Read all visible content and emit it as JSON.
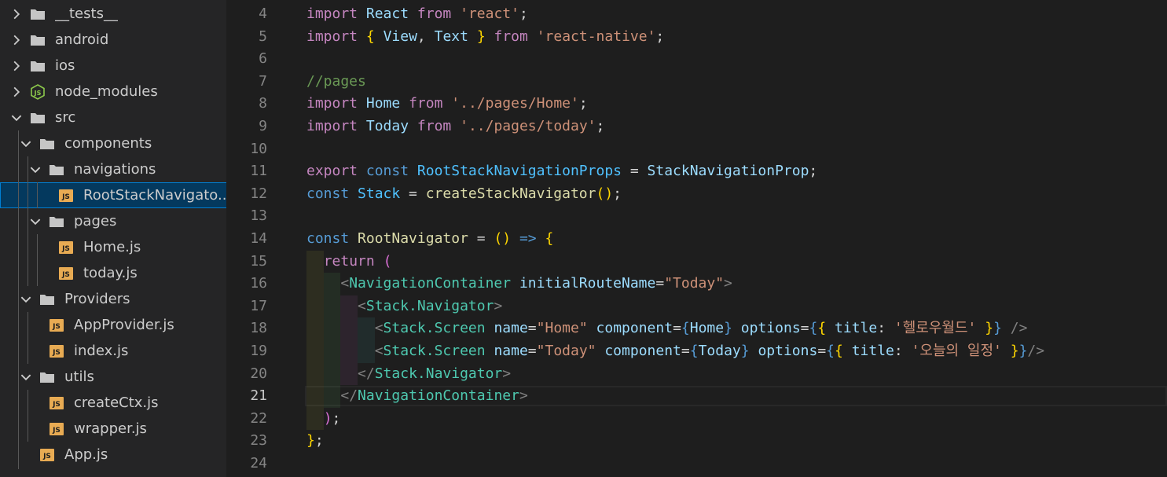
{
  "explorer": {
    "items": [
      {
        "label": "__tests__",
        "type": "folder",
        "depth": 0,
        "expanded": false
      },
      {
        "label": "android",
        "type": "folder",
        "depth": 0,
        "expanded": false
      },
      {
        "label": "ios",
        "type": "folder",
        "depth": 0,
        "expanded": false
      },
      {
        "label": "node_modules",
        "type": "node-folder",
        "depth": 0,
        "expanded": false
      },
      {
        "label": "src",
        "type": "folder",
        "depth": 0,
        "expanded": true
      },
      {
        "label": "components",
        "type": "folder",
        "depth": 1,
        "expanded": true
      },
      {
        "label": "navigations",
        "type": "folder",
        "depth": 2,
        "expanded": true
      },
      {
        "label": "RootStackNavigato...",
        "type": "js",
        "depth": 3,
        "selected": true
      },
      {
        "label": "pages",
        "type": "folder",
        "depth": 2,
        "expanded": true
      },
      {
        "label": "Home.js",
        "type": "js",
        "depth": 3
      },
      {
        "label": "today.js",
        "type": "js",
        "depth": 3
      },
      {
        "label": "Providers",
        "type": "folder",
        "depth": 1,
        "expanded": true
      },
      {
        "label": "AppProvider.js",
        "type": "js",
        "depth": 2
      },
      {
        "label": "index.js",
        "type": "js",
        "depth": 2
      },
      {
        "label": "utils",
        "type": "folder",
        "depth": 1,
        "expanded": true
      },
      {
        "label": "createCtx.js",
        "type": "js",
        "depth": 2
      },
      {
        "label": "wrapper.js",
        "type": "js",
        "depth": 2
      },
      {
        "label": "App.js",
        "type": "js",
        "depth": 1
      }
    ],
    "js_badge": "JS"
  },
  "editor": {
    "active_line": "21",
    "lines": [
      {
        "n": "4",
        "tokens": [
          [
            "k",
            "import"
          ],
          [
            "p",
            " "
          ],
          [
            "v",
            "React"
          ],
          [
            "p",
            " "
          ],
          [
            "k",
            "from"
          ],
          [
            "p",
            " "
          ],
          [
            "s",
            "'react'"
          ],
          [
            "p",
            ";"
          ]
        ]
      },
      {
        "n": "5",
        "tokens": [
          [
            "k",
            "import"
          ],
          [
            "p",
            " "
          ],
          [
            "br1",
            "{"
          ],
          [
            "p",
            " "
          ],
          [
            "v",
            "View"
          ],
          [
            "p",
            ", "
          ],
          [
            "v",
            "Text"
          ],
          [
            "p",
            " "
          ],
          [
            "br1",
            "}"
          ],
          [
            "p",
            " "
          ],
          [
            "k",
            "from"
          ],
          [
            "p",
            " "
          ],
          [
            "s",
            "'react-native'"
          ],
          [
            "p",
            ";"
          ]
        ]
      },
      {
        "n": "6",
        "tokens": []
      },
      {
        "n": "7",
        "tokens": [
          [
            "c",
            "//pages"
          ]
        ]
      },
      {
        "n": "8",
        "tokens": [
          [
            "k",
            "import"
          ],
          [
            "p",
            " "
          ],
          [
            "v",
            "Home"
          ],
          [
            "p",
            " "
          ],
          [
            "k",
            "from"
          ],
          [
            "p",
            " "
          ],
          [
            "s",
            "'../pages/Home'"
          ],
          [
            "p",
            ";"
          ]
        ]
      },
      {
        "n": "9",
        "tokens": [
          [
            "k",
            "import"
          ],
          [
            "p",
            " "
          ],
          [
            "v",
            "Today"
          ],
          [
            "p",
            " "
          ],
          [
            "k",
            "from"
          ],
          [
            "p",
            " "
          ],
          [
            "s",
            "'../pages/today'"
          ],
          [
            "p",
            ";"
          ]
        ]
      },
      {
        "n": "10",
        "tokens": []
      },
      {
        "n": "11",
        "tokens": [
          [
            "k",
            "export"
          ],
          [
            "p",
            " "
          ],
          [
            "kb",
            "const"
          ],
          [
            "p",
            " "
          ],
          [
            "t",
            "RootStackNavigationProps"
          ],
          [
            "p",
            " = "
          ],
          [
            "v",
            "StackNavigationProp"
          ],
          [
            "p",
            ";"
          ]
        ]
      },
      {
        "n": "12",
        "tokens": [
          [
            "kb",
            "const"
          ],
          [
            "p",
            " "
          ],
          [
            "t",
            "Stack"
          ],
          [
            "p",
            " = "
          ],
          [
            "f",
            "createStackNavigator"
          ],
          [
            "br1",
            "()"
          ],
          [
            "p",
            ";"
          ]
        ]
      },
      {
        "n": "13",
        "tokens": []
      },
      {
        "n": "14",
        "tokens": [
          [
            "kb",
            "const"
          ],
          [
            "p",
            " "
          ],
          [
            "f",
            "RootNavigator"
          ],
          [
            "p",
            " = "
          ],
          [
            "br1",
            "()"
          ],
          [
            "p",
            " "
          ],
          [
            "kb",
            "=>"
          ],
          [
            "p",
            " "
          ],
          [
            "br1",
            "{"
          ]
        ]
      },
      {
        "n": "15",
        "tokens": [
          [
            "p",
            "  "
          ],
          [
            "k",
            "return"
          ],
          [
            "p",
            " "
          ],
          [
            "br2",
            "("
          ]
        ]
      },
      {
        "n": "16",
        "tokens": [
          [
            "p",
            "    "
          ],
          [
            "ang",
            "<"
          ],
          [
            "tg",
            "NavigationContainer"
          ],
          [
            "p",
            " "
          ],
          [
            "a",
            "initialRouteName"
          ],
          [
            "p",
            "="
          ],
          [
            "s",
            "\"Today\""
          ],
          [
            "ang",
            ">"
          ]
        ]
      },
      {
        "n": "17",
        "tokens": [
          [
            "p",
            "      "
          ],
          [
            "ang",
            "<"
          ],
          [
            "tg",
            "Stack.Navigator"
          ],
          [
            "ang",
            ">"
          ]
        ]
      },
      {
        "n": "18",
        "tokens": [
          [
            "p",
            "        "
          ],
          [
            "ang",
            "<"
          ],
          [
            "tg",
            "Stack.Screen"
          ],
          [
            "p",
            " "
          ],
          [
            "a",
            "name"
          ],
          [
            "p",
            "="
          ],
          [
            "s",
            "\"Home\""
          ],
          [
            "p",
            " "
          ],
          [
            "a",
            "component"
          ],
          [
            "p",
            "="
          ],
          [
            "kb",
            "{"
          ],
          [
            "v",
            "Home"
          ],
          [
            "kb",
            "}"
          ],
          [
            "p",
            " "
          ],
          [
            "a",
            "options"
          ],
          [
            "p",
            "="
          ],
          [
            "kb",
            "{"
          ],
          [
            "br1",
            "{"
          ],
          [
            "p",
            " "
          ],
          [
            "v",
            "title"
          ],
          [
            "p",
            ": "
          ],
          [
            "s",
            "'헬로우월드'"
          ],
          [
            "p",
            " "
          ],
          [
            "br1",
            "}"
          ],
          [
            "kb",
            "}"
          ],
          [
            "p",
            " "
          ],
          [
            "ang",
            "/>"
          ]
        ]
      },
      {
        "n": "19",
        "tokens": [
          [
            "p",
            "        "
          ],
          [
            "ang",
            "<"
          ],
          [
            "tg",
            "Stack.Screen"
          ],
          [
            "p",
            " "
          ],
          [
            "a",
            "name"
          ],
          [
            "p",
            "="
          ],
          [
            "s",
            "\"Today\""
          ],
          [
            "p",
            " "
          ],
          [
            "a",
            "component"
          ],
          [
            "p",
            "="
          ],
          [
            "kb",
            "{"
          ],
          [
            "v",
            "Today"
          ],
          [
            "kb",
            "}"
          ],
          [
            "p",
            " "
          ],
          [
            "a",
            "options"
          ],
          [
            "p",
            "="
          ],
          [
            "kb",
            "{"
          ],
          [
            "br1",
            "{"
          ],
          [
            "p",
            " "
          ],
          [
            "v",
            "title"
          ],
          [
            "p",
            ": "
          ],
          [
            "s",
            "'오늘의 일정'"
          ],
          [
            "p",
            " "
          ],
          [
            "br1",
            "}"
          ],
          [
            "kb",
            "}"
          ],
          [
            "ang",
            "/>"
          ]
        ]
      },
      {
        "n": "20",
        "tokens": [
          [
            "p",
            "      "
          ],
          [
            "ang",
            "</"
          ],
          [
            "tg",
            "Stack.Navigator"
          ],
          [
            "ang",
            ">"
          ]
        ]
      },
      {
        "n": "21",
        "tokens": [
          [
            "p",
            "    "
          ],
          [
            "ang",
            "</"
          ],
          [
            "tg",
            "NavigationContainer"
          ],
          [
            "ang",
            ">"
          ]
        ]
      },
      {
        "n": "22",
        "tokens": [
          [
            "p",
            "  "
          ],
          [
            "br2",
            ")"
          ],
          [
            "p",
            ";"
          ]
        ]
      },
      {
        "n": "23",
        "tokens": [
          [
            "br1",
            "}"
          ],
          [
            "p",
            ";"
          ]
        ]
      },
      {
        "n": "24",
        "tokens": []
      }
    ]
  }
}
